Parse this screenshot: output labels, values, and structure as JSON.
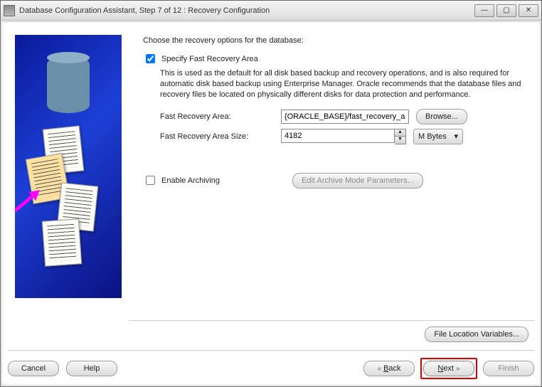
{
  "window": {
    "title": "Database Configuration Assistant, Step 7 of 12 : Recovery Configuration"
  },
  "heading": "Choose the recovery options for the database:",
  "specify": {
    "checked": true,
    "label": "Specify Fast Recovery Area",
    "description": "This is used as the default for all disk based backup and recovery operations, and is also required for automatic disk based backup using Enterprise Manager. Oracle recommends that the database files and recovery files be located on physically different disks for data protection and performance."
  },
  "fra": {
    "label": "Fast Recovery Area:",
    "value": "{ORACLE_BASE}/fast_recovery_a",
    "browse": "Browse..."
  },
  "fra_size": {
    "label": "Fast Recovery Area Size:",
    "value": "4182",
    "unit": "M Bytes"
  },
  "archive": {
    "checked": false,
    "label": "Enable Archiving",
    "edit_btn": "Edit Archive Mode Parameters..."
  },
  "file_loc_btn": "File Location Variables...",
  "footer": {
    "cancel": "Cancel",
    "help": "Help",
    "back": "Back",
    "next": "Next",
    "finish": "Finish"
  }
}
